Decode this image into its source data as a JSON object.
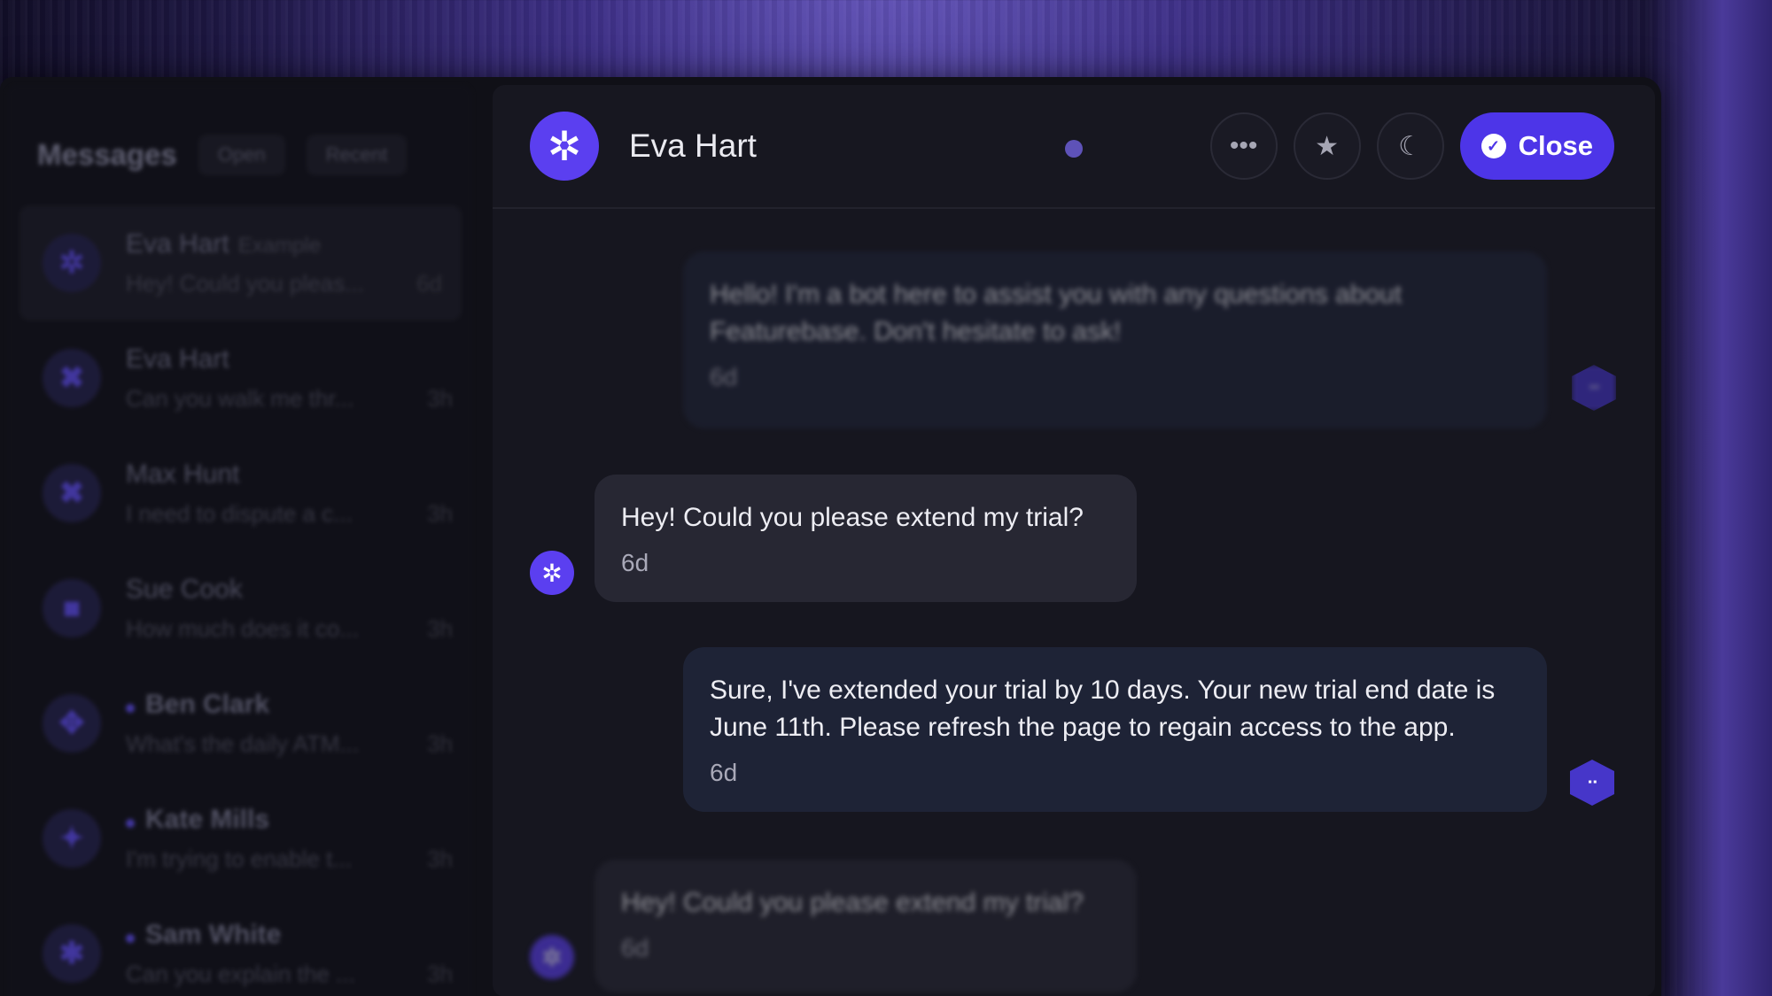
{
  "sidebar": {
    "title": "Messages",
    "filters": [
      "Open",
      "Recent"
    ],
    "conversations": [
      {
        "name": "Eva Hart",
        "tag": "Example",
        "preview": "Hey! Could you pleas...",
        "time": "6d",
        "unread": false,
        "icon": "gear-icon"
      },
      {
        "name": "Eva Hart",
        "tag": "",
        "preview": "Can you walk me thr...",
        "time": "3h",
        "unread": false,
        "icon": "x-shape-icon"
      },
      {
        "name": "Max Hunt",
        "tag": "",
        "preview": "I need to dispute a c...",
        "time": "3h",
        "unread": false,
        "icon": "x-shape-icon"
      },
      {
        "name": "Sue Cook",
        "tag": "",
        "preview": "How much does it co...",
        "time": "3h",
        "unread": false,
        "icon": "square-icon"
      },
      {
        "name": "Ben Clark",
        "tag": "",
        "preview": "What's the daily ATM...",
        "time": "3h",
        "unread": true,
        "icon": "move-icon"
      },
      {
        "name": "Kate Mills",
        "tag": "",
        "preview": "I'm trying to enable t...",
        "time": "3h",
        "unread": true,
        "icon": "sparkle-icon"
      },
      {
        "name": "Sam White",
        "tag": "",
        "preview": "Can you explain the ...",
        "time": "3h",
        "unread": true,
        "icon": "star-icon"
      }
    ]
  },
  "header": {
    "name": "Eva Hart",
    "actions": {
      "more": "more-icon",
      "star": "star-icon",
      "snooze": "moon-icon"
    },
    "close_label": "Close"
  },
  "messages": [
    {
      "from": "agent",
      "text": "Hello! I'm a bot here to assist you with any questions about Featurebase. Don't hesitate to ask!",
      "time": "6d"
    },
    {
      "from": "user",
      "text": "Hey! Could you please extend my trial?",
      "time": "6d"
    },
    {
      "from": "agent",
      "text": "Sure, I've extended your trial by 10 days. Your new trial end date is June 11th. Please refresh the page to regain access to the app.",
      "time": "6d"
    },
    {
      "from": "user",
      "text": "Hey! Could you please extend my trial?",
      "time": "6d"
    }
  ],
  "colors": {
    "accent": "#4d35e8",
    "avatar": "#5b3ff0",
    "agent_bubble": "#1e2336",
    "user_bubble": "#272733"
  }
}
